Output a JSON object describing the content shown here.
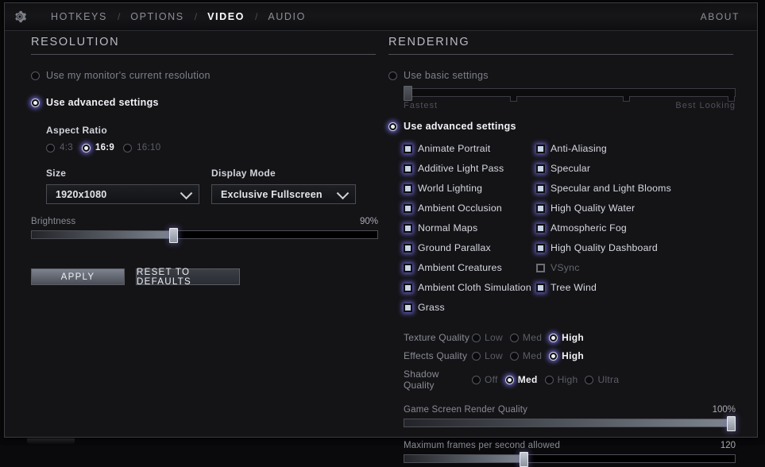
{
  "header": {
    "gear_icon": "gear-icon",
    "tabs": [
      {
        "label": "HOTKEYS",
        "active": false
      },
      {
        "label": "OPTIONS",
        "active": false
      },
      {
        "label": "VIDEO",
        "active": true
      },
      {
        "label": "AUDIO",
        "active": false
      }
    ],
    "separator": "/",
    "about_label": "ABOUT"
  },
  "resolution": {
    "title": "RESOLUTION",
    "mode_monitor": {
      "label": "Use my monitor's current resolution",
      "selected": false
    },
    "mode_advanced": {
      "label": "Use advanced settings",
      "selected": true
    },
    "aspect_ratio": {
      "label": "Aspect Ratio",
      "options": [
        {
          "label": "4:3",
          "selected": false
        },
        {
          "label": "16:9",
          "selected": true
        },
        {
          "label": "16:10",
          "selected": false
        }
      ]
    },
    "size": {
      "label": "Size",
      "value": "1920x1080"
    },
    "display_mode": {
      "label": "Display Mode",
      "value": "Exclusive Fullscreen"
    },
    "brightness": {
      "label": "Brightness",
      "value": "90%",
      "percent": 41
    },
    "apply_label": "APPLY",
    "reset_label": "RESET TO DEFAULTS"
  },
  "rendering": {
    "title": "RENDERING",
    "mode_basic": {
      "label": "Use basic settings",
      "selected": false
    },
    "quality_slider": {
      "left_label": "Fastest",
      "right_label": "Best Looking",
      "percent": 0,
      "disabled": true
    },
    "mode_advanced": {
      "label": "Use advanced settings",
      "selected": true
    },
    "checkboxes_left": [
      {
        "label": "Animate Portrait",
        "checked": true,
        "enabled": true
      },
      {
        "label": "Additive Light Pass",
        "checked": true,
        "enabled": true
      },
      {
        "label": "World Lighting",
        "checked": true,
        "enabled": true
      },
      {
        "label": "Ambient Occlusion",
        "checked": true,
        "enabled": true
      },
      {
        "label": "Normal Maps",
        "checked": true,
        "enabled": true
      },
      {
        "label": "Ground Parallax",
        "checked": true,
        "enabled": true
      },
      {
        "label": "Ambient Creatures",
        "checked": true,
        "enabled": true
      },
      {
        "label": "Ambient Cloth Simulation",
        "checked": true,
        "enabled": true
      },
      {
        "label": "Grass",
        "checked": true,
        "enabled": true
      }
    ],
    "checkboxes_right": [
      {
        "label": "Anti-Aliasing",
        "checked": true,
        "enabled": true
      },
      {
        "label": "Specular",
        "checked": true,
        "enabled": true
      },
      {
        "label": "Specular and Light Blooms",
        "checked": true,
        "enabled": true
      },
      {
        "label": "High Quality Water",
        "checked": true,
        "enabled": true
      },
      {
        "label": "Atmospheric Fog",
        "checked": true,
        "enabled": true
      },
      {
        "label": "High Quality Dashboard",
        "checked": true,
        "enabled": true
      },
      {
        "label": "VSync",
        "checked": false,
        "enabled": false
      },
      {
        "label": "Tree Wind",
        "checked": true,
        "enabled": true
      }
    ],
    "quality_rows": [
      {
        "name": "Texture Quality",
        "options": [
          {
            "label": "Low",
            "selected": false
          },
          {
            "label": "Med",
            "selected": false
          },
          {
            "label": "High",
            "selected": true
          }
        ]
      },
      {
        "name": "Effects Quality",
        "options": [
          {
            "label": "Low",
            "selected": false
          },
          {
            "label": "Med",
            "selected": false
          },
          {
            "label": "High",
            "selected": true
          }
        ]
      },
      {
        "name": "Shadow Quality",
        "options": [
          {
            "label": "Off",
            "selected": false
          },
          {
            "label": "Med",
            "selected": true
          },
          {
            "label": "High",
            "selected": false
          },
          {
            "label": "Ultra",
            "selected": false
          }
        ]
      }
    ],
    "render_quality": {
      "label": "Game Screen Render Quality",
      "value": "100%",
      "percent": 100
    },
    "max_fps": {
      "label": "Maximum frames per second allowed",
      "value": "120",
      "percent": 36
    }
  }
}
